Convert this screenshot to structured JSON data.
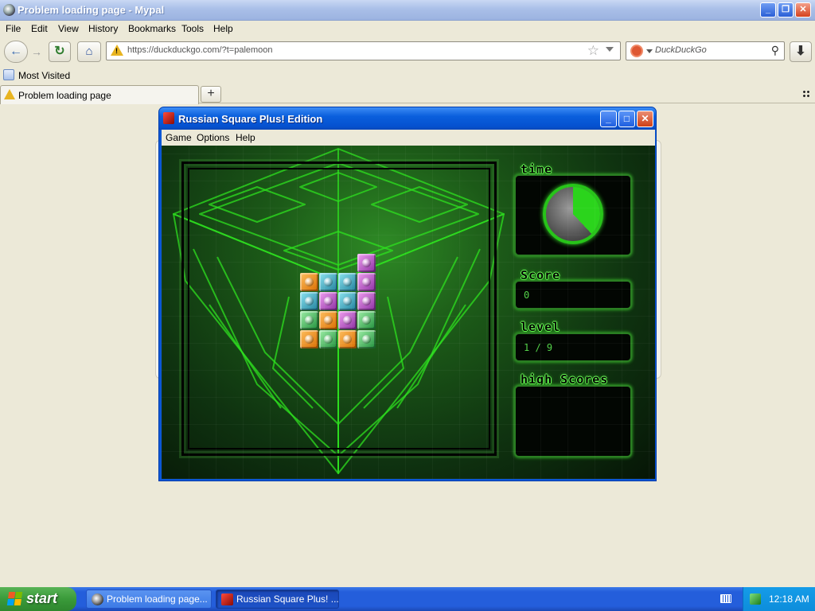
{
  "browser": {
    "title": "Problem loading page - Mypal",
    "menu": [
      "File",
      "Edit",
      "View",
      "History",
      "Bookmarks",
      "Tools",
      "Help"
    ],
    "url": "https://duckduckgo.com/?t=palemoon",
    "search_placeholder": "DuckDuckGo",
    "bookmark": "Most Visited",
    "tab_label": "Problem loading page",
    "window_buttons": {
      "minimize": "_",
      "restore": "❐",
      "close": "✕"
    },
    "nav_icons": {
      "back": "back-arrow-icon",
      "forward": "forward-arrow-icon",
      "reload": "reload-icon",
      "home": "home-icon",
      "download": "download-icon"
    },
    "new_tab_glyph": "+"
  },
  "game": {
    "title": "Russian Square Plus! Edition",
    "menu": [
      "Game",
      "Options",
      "Help"
    ],
    "panels": {
      "time_label": "time",
      "score_label": "Score",
      "score_value": "0",
      "level_label": "level",
      "level_value": "1 / 9",
      "high_scores_label": "high Scores"
    },
    "timer_elapsed_fraction": 0.38,
    "block_colors": {
      "orange": "#f09a20",
      "blue": "#3ab6d0",
      "purple": "#c053c8",
      "green": "#3cbf55"
    },
    "blocks": [
      {
        "row": 0,
        "col": 3,
        "color": "purple"
      },
      {
        "row": 1,
        "col": 0,
        "color": "orange"
      },
      {
        "row": 1,
        "col": 1,
        "color": "blue"
      },
      {
        "row": 1,
        "col": 2,
        "color": "blue"
      },
      {
        "row": 1,
        "col": 3,
        "color": "purple"
      },
      {
        "row": 2,
        "col": 0,
        "color": "blue"
      },
      {
        "row": 2,
        "col": 1,
        "color": "purple"
      },
      {
        "row": 2,
        "col": 2,
        "color": "blue"
      },
      {
        "row": 2,
        "col": 3,
        "color": "purple"
      },
      {
        "row": 3,
        "col": 0,
        "color": "green"
      },
      {
        "row": 3,
        "col": 1,
        "color": "orange"
      },
      {
        "row": 3,
        "col": 2,
        "color": "purple"
      },
      {
        "row": 3,
        "col": 3,
        "color": "green"
      },
      {
        "row": 4,
        "col": 0,
        "color": "orange"
      },
      {
        "row": 4,
        "col": 1,
        "color": "green"
      },
      {
        "row": 4,
        "col": 2,
        "color": "orange"
      },
      {
        "row": 4,
        "col": 3,
        "color": "green"
      }
    ]
  },
  "taskbar": {
    "start_label": "start",
    "tasks": [
      "Problem loading page...",
      "Russian Square Plus! ..."
    ],
    "clock": "12:18 AM"
  }
}
